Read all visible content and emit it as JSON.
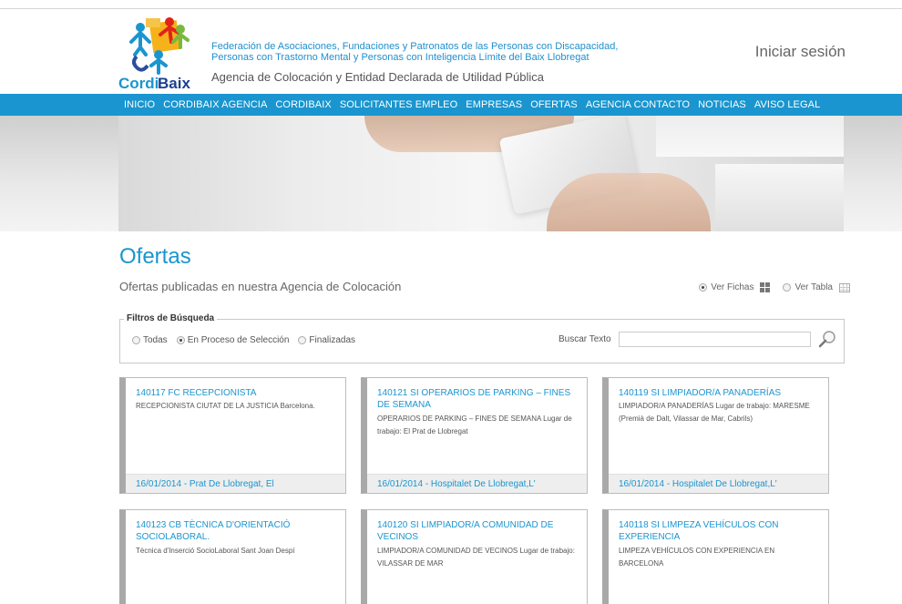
{
  "header": {
    "logo_text": "CordiBaix",
    "org_line1": "Federación de Asociaciones, Fundaciones y Patronatos de las Personas con Discapacidad,",
    "org_line2": "Personas con Trastorno Mental y Personas con Inteligencia Límite del Baix Llobregat",
    "agency": "Agencia de Colocación y Entidad Declarada de Utilidad Pública",
    "login": "Iniciar sesión"
  },
  "nav": {
    "items": [
      "INICIO",
      "CORDIBAIX AGENCIA",
      "CORDIBAIX",
      "SOLICITANTES EMPLEO",
      "EMPRESAS",
      "OFERTAS",
      "AGENCIA CONTACTO",
      "NOTICIAS",
      "AVISO LEGAL"
    ]
  },
  "main": {
    "title": "Ofertas",
    "subtitle": "Ofertas publicadas en nuestra Agencia de Colocación",
    "view_cards": "Ver Fichas",
    "view_table": "Ver Tabla"
  },
  "filters": {
    "legend": "Filtros de Búsqueda",
    "options": [
      "Todas",
      "En Proceso de Selección",
      "Finalizadas"
    ],
    "selected": "En Proceso de Selección",
    "search_label": "Buscar Texto",
    "search_value": ""
  },
  "offers": [
    {
      "title": "140117 FC RECEPCIONISTA",
      "desc": "RECEPCIONISTA CIUTAT DE LA JUSTICIA Barcelona.",
      "footer": "16/01/2014 - Prat De Llobregat, El"
    },
    {
      "title": "140121 SI OPERARIOS DE PARKING – FINES DE SEMANA",
      "desc": "OPERARIOS DE PARKING – FINES DE SEMANA Lugar de trabajo: El Prat de Llobregat",
      "footer": "16/01/2014 - Hospitalet De Llobregat,L'"
    },
    {
      "title": "140119 SI LIMPIADOR/A PANADERÍAS",
      "desc": "LIMPIADOR/A PANADERÍAS Lugar de trabajo: MARESME (Premià de Dalt, Vilassar de Mar, Cabrils)",
      "footer": "16/01/2014 - Hospitalet De Llobregat,L'"
    },
    {
      "title": "140123 CB TÈCNICA D'ORIENTACIÓ SOCIOLABORAL.",
      "desc": "Tècnica d'Inserció SocioLaboral Sant Joan Despí",
      "footer": ""
    },
    {
      "title": "140120 SI LIMPIADOR/A COMUNIDAD DE VECINOS",
      "desc": "LIMPIADOR/A COMUNIDAD DE VECINOS Lugar de trabajo: VILASSAR DE MAR",
      "footer": ""
    },
    {
      "title": "140118 SI LIMPEZA VEHÍCULOS CON EXPERIENCIA",
      "desc": "LIMPEZA VEHÍCULOS CON EXPERIENCIA EN BARCELONA",
      "footer": ""
    }
  ]
}
